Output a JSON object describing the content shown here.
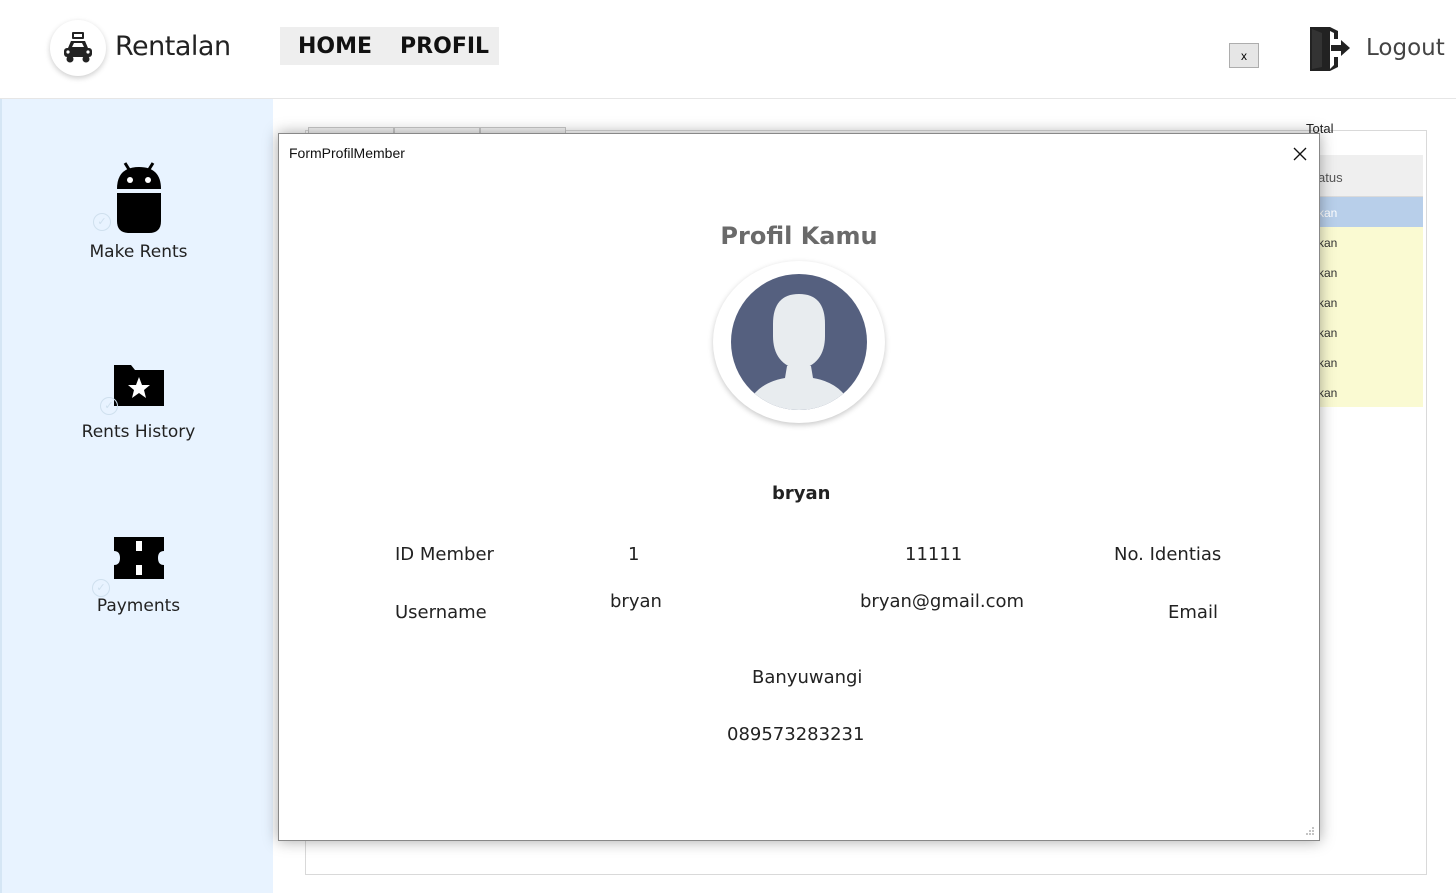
{
  "header": {
    "brand": "Rentalan",
    "nav": [
      "HOME",
      "PROFIL"
    ],
    "close_label": "x",
    "logout_label": "Logout"
  },
  "sidebar": {
    "items": [
      {
        "label": "Make Rents",
        "icon": "android-icon"
      },
      {
        "label": "Rents History",
        "icon": "star-folder-icon"
      },
      {
        "label": "Payments",
        "icon": "ticket-icon"
      }
    ]
  },
  "background": {
    "total_label": "Total",
    "grid_header": "atus",
    "grid_rows": [
      "kan",
      "kan",
      "kan",
      "kan",
      "kan",
      "kan",
      "kan"
    ]
  },
  "modal": {
    "title": "FormProfilMember",
    "heading": "Profil Kamu",
    "name": "bryan",
    "id_member_label": "ID Member",
    "id_member_value": "1",
    "identity_value": "11111",
    "identity_label": "No. Identias",
    "username_label": "Username",
    "username_value": "bryan",
    "email_value": "bryan@gmail.com",
    "email_label": "Email",
    "address": "Banyuwangi",
    "phone": "089573283231"
  },
  "colors": {
    "sidebar_bg": "#e8f3ff",
    "grid_row_bg": "#fafad2",
    "grid_selected_bg": "#b8cfea",
    "avatar_bg": "#55607f"
  }
}
